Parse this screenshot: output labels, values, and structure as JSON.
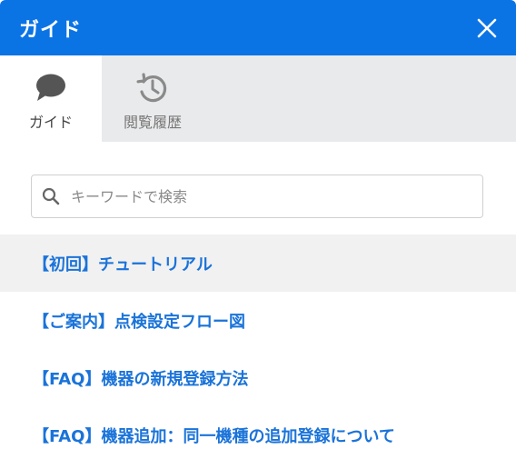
{
  "header": {
    "title": "ガイド",
    "close_icon": "close-icon",
    "background": "#0b74e5"
  },
  "tabs": [
    {
      "label": "ガイド",
      "icon": "chat-bubble-icon",
      "active": true
    },
    {
      "label": "閲覧履歴",
      "icon": "history-icon",
      "active": false
    }
  ],
  "search": {
    "placeholder": "キーワードで検索",
    "value": "",
    "icon": "search-icon"
  },
  "articles": [
    {
      "title": "【初回】チュートリアル"
    },
    {
      "title": "【ご案内】点検設定フロー図"
    },
    {
      "title": "【FAQ】機器の新規登録方法"
    },
    {
      "title": "【FAQ】機器追加：同一機種の追加登録について"
    }
  ],
  "colors": {
    "accent": "#0b74e5",
    "link": "#1a73d9",
    "tab_bar": "#e9eaeb",
    "hover_row": "#f1f1f1"
  }
}
